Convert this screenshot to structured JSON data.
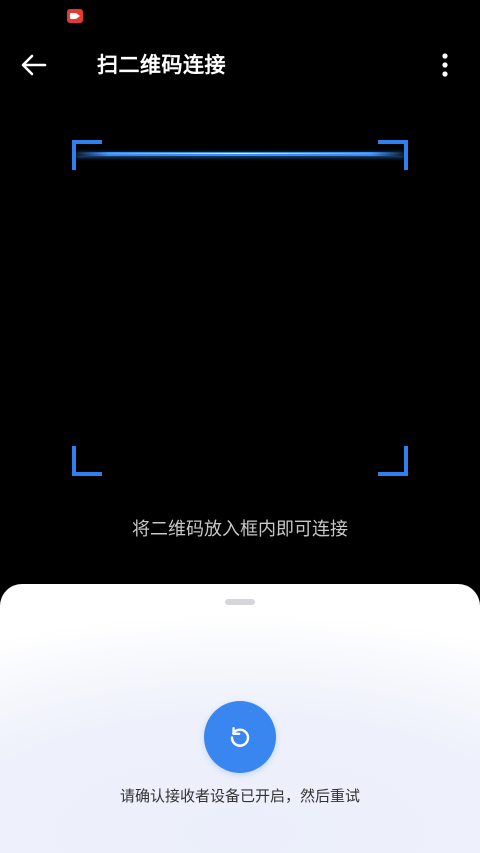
{
  "status_bar": {
    "indicator_icon": "screen-record-icon",
    "indicator_color": "#e53935"
  },
  "app_bar": {
    "back_icon": "arrow-left-icon",
    "title": "扫二维码连接",
    "more_icon": "more-vertical-icon"
  },
  "scanner": {
    "hint": "将二维码放入框内即可连接",
    "accent_color": "#2f80ed"
  },
  "bottom_sheet": {
    "retry_icon": "refresh-icon",
    "retry_button_color": "#3a86f0",
    "hint": "请确认接收者设备已开启，然后重试"
  }
}
